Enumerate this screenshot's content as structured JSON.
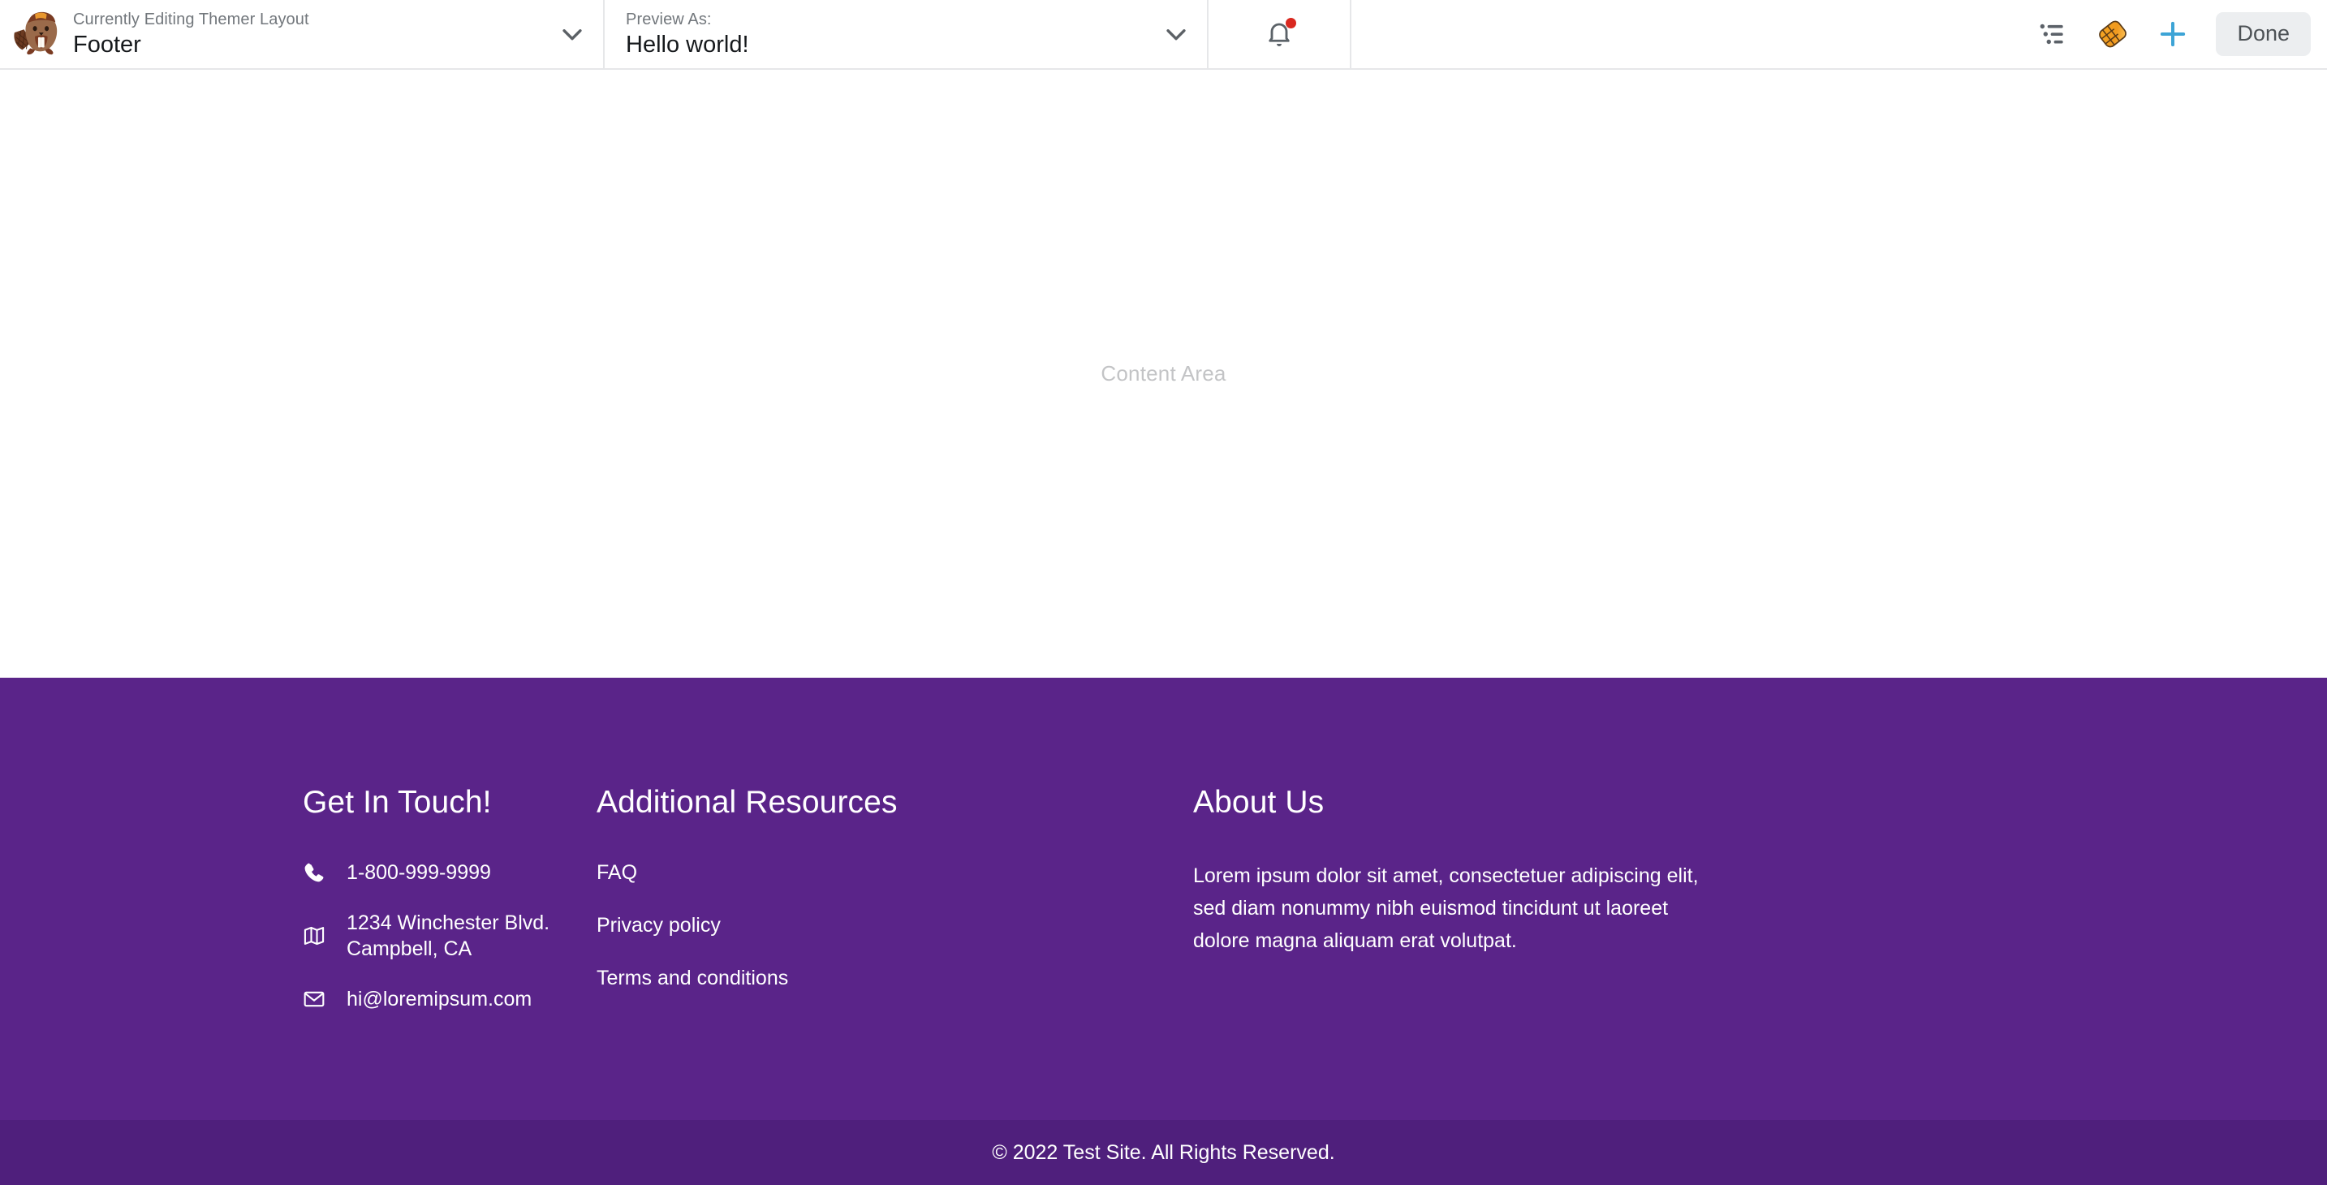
{
  "toolbar": {
    "logo_icon": "beaver-builder-logo",
    "editing": {
      "label": "Currently Editing Themer Layout",
      "value": "Footer",
      "chevron_icon": "chevron-down-icon"
    },
    "preview": {
      "label": "Preview As:",
      "value": "Hello world!",
      "chevron_icon": "chevron-down-icon"
    },
    "notifications": {
      "icon": "bell-icon",
      "has_unread": true,
      "dot_color": "#d9281f"
    },
    "actions": {
      "outline_icon": "outline-list-icon",
      "templates_icon": "waffle-icon",
      "add_icon": "plus-icon",
      "add_icon_color": "#3da4d6",
      "done_label": "Done"
    }
  },
  "content": {
    "placeholder": "Content Area"
  },
  "footer": {
    "background_color": "#5a2489",
    "bottom_bar_color": "#4f1f7c",
    "columns": [
      {
        "heading": "Get In Touch!",
        "type": "contact",
        "items": [
          {
            "icon": "phone-icon",
            "text": "1-800-999-9999"
          },
          {
            "icon": "map-icon",
            "text": "1234 Winchester Blvd. Campbell, CA"
          },
          {
            "icon": "envelope-icon",
            "text": "hi@loremipsum.com"
          }
        ]
      },
      {
        "heading": "Additional Resources",
        "type": "links",
        "items": [
          {
            "text": "FAQ"
          },
          {
            "text": "Privacy policy"
          },
          {
            "text": "Terms and conditions"
          }
        ]
      },
      {
        "heading": "About Us",
        "type": "text",
        "body": "Lorem ipsum dolor sit amet, consectetuer adipiscing elit, sed diam nonummy nibh euismod tincidunt ut laoreet dolore magna aliquam erat volutpat."
      }
    ],
    "copyright": "© 2022 Test Site. All Rights Reserved."
  }
}
